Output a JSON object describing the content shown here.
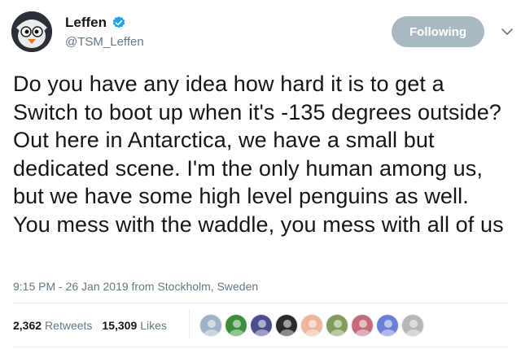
{
  "header": {
    "display_name": "Leffen",
    "handle": "@TSM_Leffen",
    "follow_label": "Following"
  },
  "tweet": {
    "text": "Do you have any idea how hard it is to get a Switch to boot up when it's -135 degrees outside? Out here in Antarctica, we have a small but dedicated scene. I'm the only human among us, but we have some high level penguins as well. You mess with the waddle, you mess with all of us",
    "time": "9:15 PM - 26 Jan 2019",
    "from_label": "from",
    "location": "Stockholm, Sweden"
  },
  "stats": {
    "retweets_count": "2,362",
    "retweets_label": "Retweets",
    "likes_count": "15,309",
    "likes_label": "Likes"
  },
  "colors": {
    "accent": "#1da1f2",
    "following_button": "#aab8c2",
    "secondary_text": "#657786"
  },
  "likers": [
    {
      "icon": "liker-avatar-1",
      "color": "#9fb3c8"
    },
    {
      "icon": "liker-avatar-2",
      "color": "#3b8f3b"
    },
    {
      "icon": "liker-avatar-3",
      "color": "#4a4e8c"
    },
    {
      "icon": "liker-avatar-4",
      "color": "#2b2b2b"
    },
    {
      "icon": "liker-avatar-5",
      "color": "#f0b49a"
    },
    {
      "icon": "liker-avatar-6",
      "color": "#7f9c5a"
    },
    {
      "icon": "liker-avatar-7",
      "color": "#c46b7a"
    },
    {
      "icon": "liker-avatar-8",
      "color": "#6a7fd6"
    },
    {
      "icon": "liker-avatar-9",
      "color": "#b7b7b7"
    }
  ]
}
